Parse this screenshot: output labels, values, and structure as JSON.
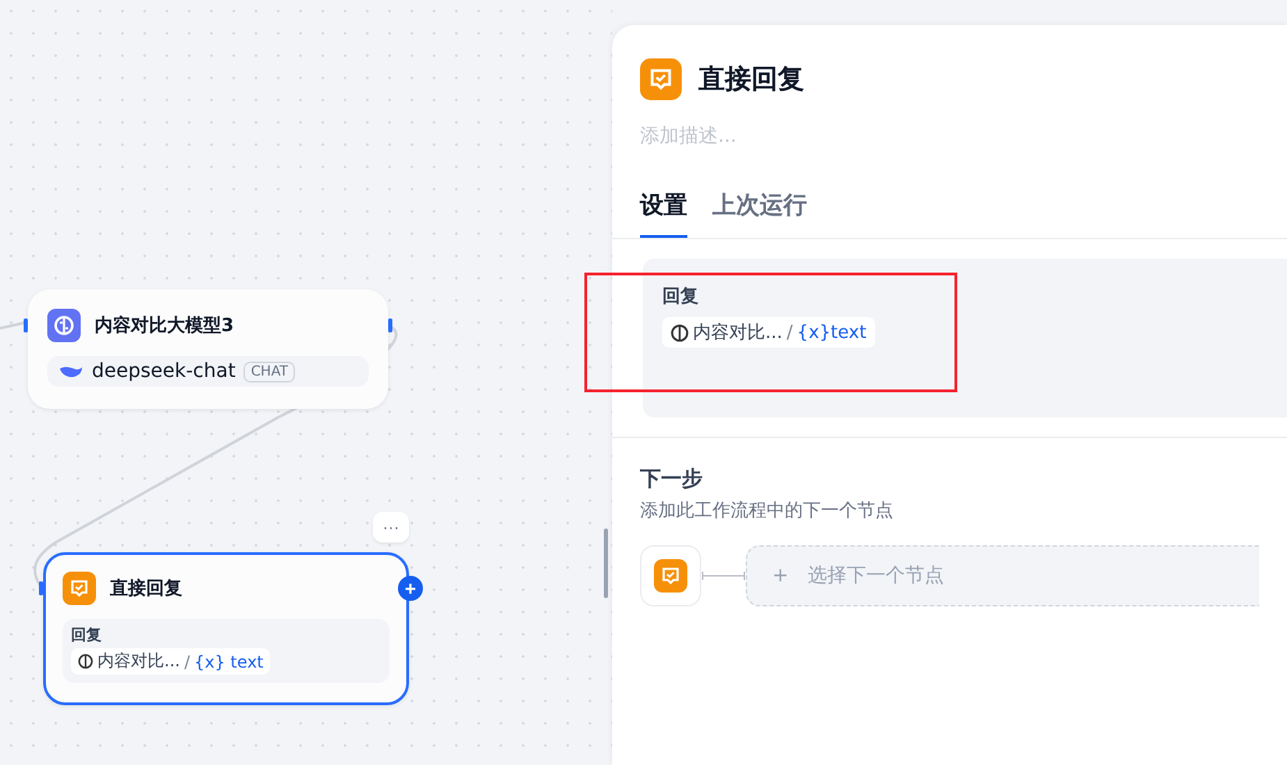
{
  "canvas": {
    "nodes": [
      {
        "kind": "llm",
        "title": "内容对比大模型3",
        "model": "deepseek-chat",
        "badge": "CHAT",
        "selected": false
      },
      {
        "kind": "answer",
        "title": "直接回复",
        "field_label": "回复",
        "variable": {
          "node": "内容对比...",
          "sep": "/",
          "prefix": "{x}",
          "name": "text"
        },
        "selected": true
      }
    ],
    "more_button": "···",
    "add_button": "+"
  },
  "panel": {
    "title": "直接回复",
    "description": {
      "placeholder": "添加描述..."
    },
    "tabs": [
      {
        "label": "设置",
        "selected": true
      },
      {
        "label": "上次运行",
        "selected": false
      }
    ],
    "reply": {
      "label": "回复",
      "variable": {
        "node": "内容对比...",
        "sep": "/",
        "prefix": "{x}",
        "name": "text"
      }
    },
    "next_step": {
      "title": "下一步",
      "subtitle": "添加此工作流程中的下一个节点",
      "add_icon": "+",
      "select_label": "选择下一个节点"
    }
  }
}
